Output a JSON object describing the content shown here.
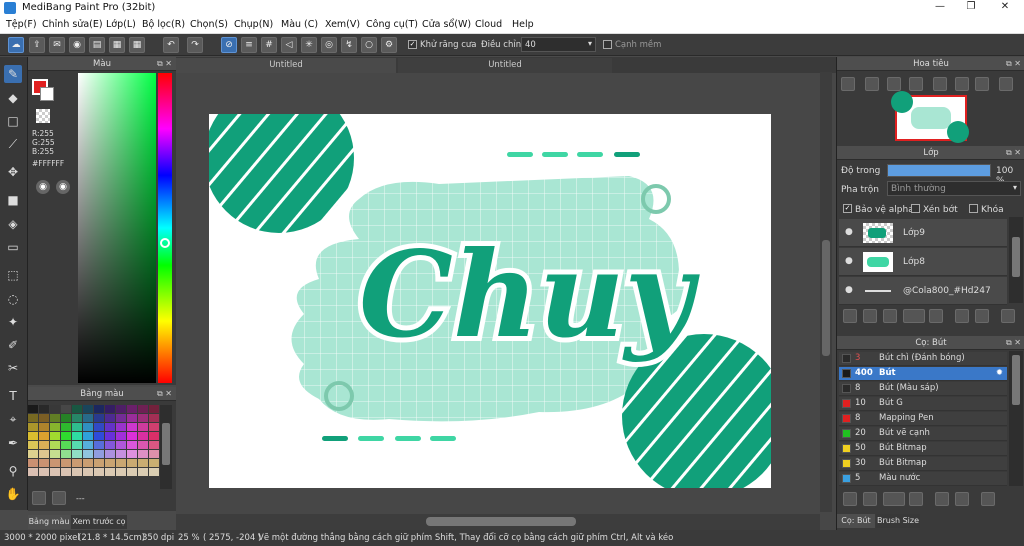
{
  "app": {
    "title": "MediBang Paint Pro (32bit)"
  },
  "menu": [
    "Tệp(F)",
    "Chỉnh sửa(E)",
    "Lớp(L)",
    "Bộ lọc(R)",
    "Chọn(S)",
    "Chụp(N)",
    "Màu (C)",
    "Xem(V)",
    "Công cụ(T)",
    "Cửa sổ(W)",
    "Cloud",
    "Help"
  ],
  "toolbar": {
    "antialias_label": "Khử răng cưa",
    "correction_label": "Điều chỉnh",
    "correction_value": "40",
    "snap_label": "Cạnh mềm"
  },
  "color_panel": {
    "title": "Màu",
    "r": "R:255",
    "g": "G:255",
    "b": "B:255",
    "hex": "#FFFFFF"
  },
  "palette_panel": {
    "title": "Bảng màu",
    "tab1": "Bảng màu",
    "tab2": "Xem trước cọ",
    "dash": "---"
  },
  "tabs": [
    "Untitled",
    "Untitled"
  ],
  "navigator": {
    "title": "Hoa tiêu"
  },
  "layers": {
    "title": "Lớp",
    "opacity_label": "Độ trong",
    "opacity_value": "100 %",
    "opacity_fraction": 1.0,
    "blend_label": "Pha trộn",
    "blend_value": "Bình thường",
    "protect_alpha": "Bảo vệ alpha",
    "clipping": "Xén bớt",
    "lock": "Khóa",
    "items": [
      {
        "name": "Lớp9"
      },
      {
        "name": "Lớp8"
      },
      {
        "name": "@Cola800_#Hd247"
      }
    ]
  },
  "brush_panel": {
    "title": "Cọ: Bút",
    "tab1": "Cọ: Bút",
    "tab2": "Brush Size",
    "items": [
      {
        "size": "3",
        "name": "Bút chì (Đánh bóng)",
        "color": "#2a2a2a"
      },
      {
        "size": "400",
        "name": "Bút",
        "color": "#1a1a1a"
      },
      {
        "size": "8",
        "name": "Bút (Màu sáp)",
        "color": "#2a2a2a"
      },
      {
        "size": "10",
        "name": "Bút G",
        "color": "#e02020"
      },
      {
        "size": "8",
        "name": "Mapping Pen",
        "color": "#e02020"
      },
      {
        "size": "20",
        "name": "Bút vẽ cạnh",
        "color": "#20c020"
      },
      {
        "size": "50",
        "name": "Bút Bitmap",
        "color": "#f0d020"
      },
      {
        "size": "30",
        "name": "Bút Bitmap",
        "color": "#f0d020"
      },
      {
        "size": "5",
        "name": "Màu nước",
        "color": "#3aa0e0"
      }
    ]
  },
  "canvas_art": {
    "text": "Chuy"
  },
  "status": {
    "size": "3000 * 2000 pixel",
    "physical": "(21.8 * 14.5cm)",
    "dpi": "350 dpi",
    "zoom": "25 %",
    "coords": "( 2575, -204 )",
    "hint": "Vẽ một đường thẳng bằng cách giữ phím Shift, Thay đổi cỡ cọ bằng cách giữ phím Ctrl, Alt và kéo"
  },
  "colors": {
    "accent": "#3a78c8",
    "art_green": "#11a07a",
    "art_mint": "#a9e6d3"
  }
}
